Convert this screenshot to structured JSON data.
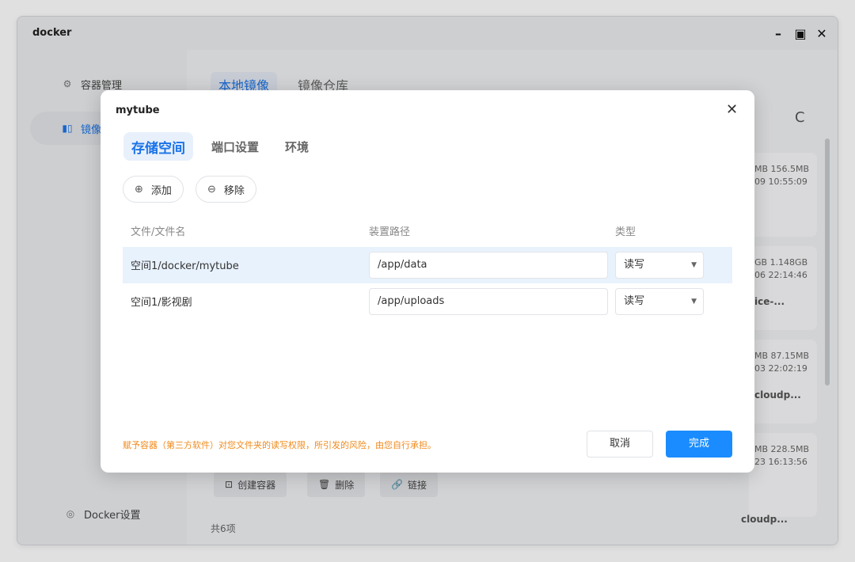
{
  "window": {
    "title": "docker",
    "minimize": "–",
    "maximize": "▣",
    "close": "✕"
  },
  "sidebar": {
    "items": [
      {
        "label": "容器管理",
        "icon": "container-icon"
      },
      {
        "label": "镜像",
        "icon": "image-icon"
      },
      {
        "label": "Docker设置",
        "icon": "settings-icon"
      }
    ]
  },
  "main": {
    "tabs": [
      "本地镜像",
      "镜像仓库"
    ],
    "cards": [
      {
        "size": "MB 156.5MB",
        "date": "09 10:55:09",
        "name": ""
      },
      {
        "size": "GB 1.148GB",
        "date": "06 22:14:46",
        "name": "ice-..."
      },
      {
        "size": "MB 87.15MB",
        "date": "03 22:02:19",
        "name": "cloudp..."
      },
      {
        "size": "MB 228.5MB",
        "date": "23 16:13:56",
        "name": "cloudp..."
      }
    ],
    "actions": {
      "create": "创建容器",
      "delete": "删除",
      "link": "链接"
    },
    "footer": "共6项"
  },
  "dialog": {
    "title": "mytube",
    "close": "✕",
    "tabs": [
      "存储空间",
      "端口设置",
      "环境"
    ],
    "add_label": "添加",
    "remove_label": "移除",
    "columns": [
      "文件/文件名",
      "装置路径",
      "类型"
    ],
    "rows": [
      {
        "name": "空间1/docker/mytube",
        "path": "/app/data",
        "type": "读写"
      },
      {
        "name": "空间1/影视剧",
        "path": "/app/uploads",
        "type": "读写"
      }
    ],
    "warning": "赋予容器（第三方软件）对您文件夹的读写权限，所引发的风险，由您自行承担。",
    "cancel": "取消",
    "confirm": "完成"
  },
  "colors": {
    "accent": "#1a73e8",
    "primary_button": "#1a8cff",
    "warning": "#f08a1c"
  }
}
